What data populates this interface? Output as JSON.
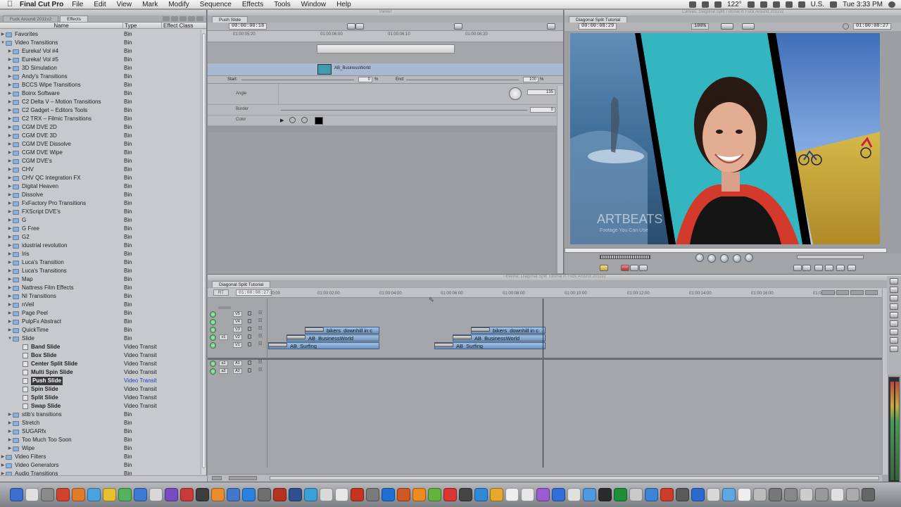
{
  "menubar": {
    "app_name": "Final Cut Pro",
    "items": [
      "File",
      "Edit",
      "View",
      "Mark",
      "Modify",
      "Sequence",
      "Effects",
      "Tools",
      "Window",
      "Help"
    ],
    "temperature": "122°",
    "input_source": "U.S.",
    "clock": "Tue 3:33 PM"
  },
  "browser": {
    "tabs": [
      "Fuck Around 2011v2",
      "Effects"
    ],
    "columns": [
      "Name",
      "Type",
      "Effect Class"
    ],
    "rows": [
      {
        "name": "Favorites",
        "type": "Bin",
        "class": "",
        "level": 0,
        "open": false
      },
      {
        "name": "Video Transitions",
        "type": "Bin",
        "class": "",
        "level": 0,
        "open": true
      },
      {
        "name": "Eureka! Vol #4",
        "type": "Bin",
        "class": "",
        "level": 1
      },
      {
        "name": "Eureka! Vol #5",
        "type": "Bin",
        "class": "",
        "level": 1
      },
      {
        "name": "3D Simulation",
        "type": "Bin",
        "class": "",
        "level": 1
      },
      {
        "name": "Andy's Transitions",
        "type": "Bin",
        "class": "",
        "level": 1
      },
      {
        "name": "BCCS Wipe Transitions",
        "type": "Bin",
        "class": "",
        "level": 1
      },
      {
        "name": "Boinx Software",
        "type": "Bin",
        "class": "",
        "level": 1
      },
      {
        "name": "C2 Delta V – Motion Transitions",
        "type": "Bin",
        "class": "",
        "level": 1
      },
      {
        "name": "C2 Gadget – Editors Tools",
        "type": "Bin",
        "class": "",
        "level": 1
      },
      {
        "name": "C2 TRX – Filmic Transitions",
        "type": "Bin",
        "class": "",
        "level": 1
      },
      {
        "name": "CGM DVE 2D",
        "type": "Bin",
        "class": "",
        "level": 1
      },
      {
        "name": "CGM DVE 3D",
        "type": "Bin",
        "class": "",
        "level": 1
      },
      {
        "name": "CGM DVE Dissolve",
        "type": "Bin",
        "class": "",
        "level": 1
      },
      {
        "name": "CGM DVE Wipe",
        "type": "Bin",
        "class": "",
        "level": 1
      },
      {
        "name": "CGM DVE's",
        "type": "Bin",
        "class": "",
        "level": 1
      },
      {
        "name": "CHV",
        "type": "Bin",
        "class": "",
        "level": 1
      },
      {
        "name": "CHV QC Integration FX",
        "type": "Bin",
        "class": "",
        "level": 1
      },
      {
        "name": "Digital Heaven",
        "type": "Bin",
        "class": "",
        "level": 1
      },
      {
        "name": "Dissolve",
        "type": "Bin",
        "class": "",
        "level": 1
      },
      {
        "name": "FxFactory Pro Transitions",
        "type": "Bin",
        "class": "",
        "level": 1
      },
      {
        "name": "FXScript DVE's",
        "type": "Bin",
        "class": "",
        "level": 1
      },
      {
        "name": "G",
        "type": "Bin",
        "class": "",
        "level": 1
      },
      {
        "name": "G Free",
        "type": "Bin",
        "class": "",
        "level": 1
      },
      {
        "name": "G2",
        "type": "Bin",
        "class": "",
        "level": 1
      },
      {
        "name": "idustrial revolution",
        "type": "Bin",
        "class": "",
        "level": 1
      },
      {
        "name": "Iris",
        "type": "Bin",
        "class": "",
        "level": 1
      },
      {
        "name": "Luca's Transition",
        "type": "Bin",
        "class": "",
        "level": 1
      },
      {
        "name": "Luca's Transitions",
        "type": "Bin",
        "class": "",
        "level": 1
      },
      {
        "name": "Map",
        "type": "Bin",
        "class": "",
        "level": 1
      },
      {
        "name": "Nattress Film Effects",
        "type": "Bin",
        "class": "",
        "level": 1
      },
      {
        "name": "NI Transitions",
        "type": "Bin",
        "class": "",
        "level": 1
      },
      {
        "name": "nVeil",
        "type": "Bin",
        "class": "",
        "level": 1
      },
      {
        "name": "Page Peel",
        "type": "Bin",
        "class": "",
        "level": 1
      },
      {
        "name": "PulpFx Abstract",
        "type": "Bin",
        "class": "",
        "level": 1
      },
      {
        "name": "QuickTime",
        "type": "Bin",
        "class": "",
        "level": 1
      },
      {
        "name": "Slide",
        "type": "Bin",
        "class": "",
        "level": 1,
        "open": true
      },
      {
        "name": "Band Slide",
        "type": "Video Transit",
        "class": "",
        "level": 2
      },
      {
        "name": "Box Slide",
        "type": "Video Transit",
        "class": "",
        "level": 2
      },
      {
        "name": "Center Split Slide",
        "type": "Video Transit",
        "class": "",
        "level": 2
      },
      {
        "name": "Multi Spin Slide",
        "type": "Video Transit",
        "class": "",
        "level": 2
      },
      {
        "name": "Push Slide",
        "type": "Video Transit",
        "class": "",
        "level": 2,
        "selected": true
      },
      {
        "name": "Spin Slide",
        "type": "Video Transit",
        "class": "",
        "level": 2
      },
      {
        "name": "Split Slide",
        "type": "Video Transit",
        "class": "",
        "level": 2
      },
      {
        "name": "Swap Slide",
        "type": "Video Transit",
        "class": "",
        "level": 2
      },
      {
        "name": "stib's transitions",
        "type": "Bin",
        "class": "",
        "level": 1
      },
      {
        "name": "Stretch",
        "type": "Bin",
        "class": "",
        "level": 1
      },
      {
        "name": "SUGARfx",
        "type": "Bin",
        "class": "",
        "level": 1
      },
      {
        "name": "Too Much Too Soon",
        "type": "Bin",
        "class": "",
        "level": 1
      },
      {
        "name": "Wipe",
        "type": "Bin",
        "class": "",
        "level": 1
      },
      {
        "name": "Video Filters",
        "type": "Bin",
        "class": "",
        "level": 0
      },
      {
        "name": "Video Generators",
        "type": "Bin",
        "class": "",
        "level": 0
      },
      {
        "name": "Audio Transitions",
        "type": "Bin",
        "class": "",
        "level": 0
      }
    ]
  },
  "viewer": {
    "window_title": "Viewer",
    "tab": "Push Slide",
    "duration_tc": "00:00:00:18",
    "ruler_ticks": [
      "01:00:06:00",
      "01:00:06:10",
      "01:00:06:20"
    ],
    "ruler_tick_first": "01:00:05:20",
    "clip_name": "AB_BusinessWorld",
    "start_label": "Start:",
    "start_value": "0",
    "start_unit": "%",
    "end_label": "End:",
    "end_value": "100",
    "end_unit": "%",
    "params": [
      {
        "label": "Angle",
        "value": "135"
      },
      {
        "label": "Border",
        "value": "0"
      },
      {
        "label": "Color",
        "value": ""
      }
    ]
  },
  "canvas": {
    "window_title": "Canvas: Diagonal Split Tutorial in Fuck Around 2011v2",
    "tab": "Diagonal Split Tutorial",
    "current_tc": "00:00:08:29",
    "zoom": "100%",
    "duration_tc": "01:00:08:27",
    "watermark": "ARTBEATS",
    "watermark_sub": "Footage You Can Use"
  },
  "timeline": {
    "window_title": "Timeline: Diagonal Split Tutorial in Fuck Around 2011v2",
    "tab": "Diagonal Split Tutorial",
    "rt": "RT",
    "timecode": "01:00:08:27",
    "ruler_ticks": [
      "00:00",
      "01:00:02:00",
      "01:00:04:00",
      "01:00:06:00",
      "01:00:08:00",
      "01:00:10:00",
      "01:00:12:00",
      "01:00:14:00",
      "01:00:16:00",
      "01:00:18:00"
    ],
    "video_tracks": [
      "V5",
      "V4",
      "V3",
      "V2",
      "V1"
    ],
    "audio_tracks": [
      "A1",
      "A2"
    ],
    "source_video": "v1",
    "source_audio": [
      "a1",
      "a2"
    ],
    "clips": [
      {
        "label": "bikers_downhill in c",
        "track": "V3"
      },
      {
        "label": "AB_BusinessWorld",
        "track": "V2"
      },
      {
        "label": "AB_Surfing",
        "track": "V1"
      },
      {
        "label": "bikers_downhill in c",
        "track": "V3"
      },
      {
        "label": "AB_BusinessWorld",
        "track": "V2"
      },
      {
        "label": "AB_Surfing",
        "track": "V1"
      }
    ]
  },
  "colors": {
    "clip_blue": "#8fb4dc",
    "selection": "#3a3a3a",
    "selected_type_text": "#1843c7"
  }
}
